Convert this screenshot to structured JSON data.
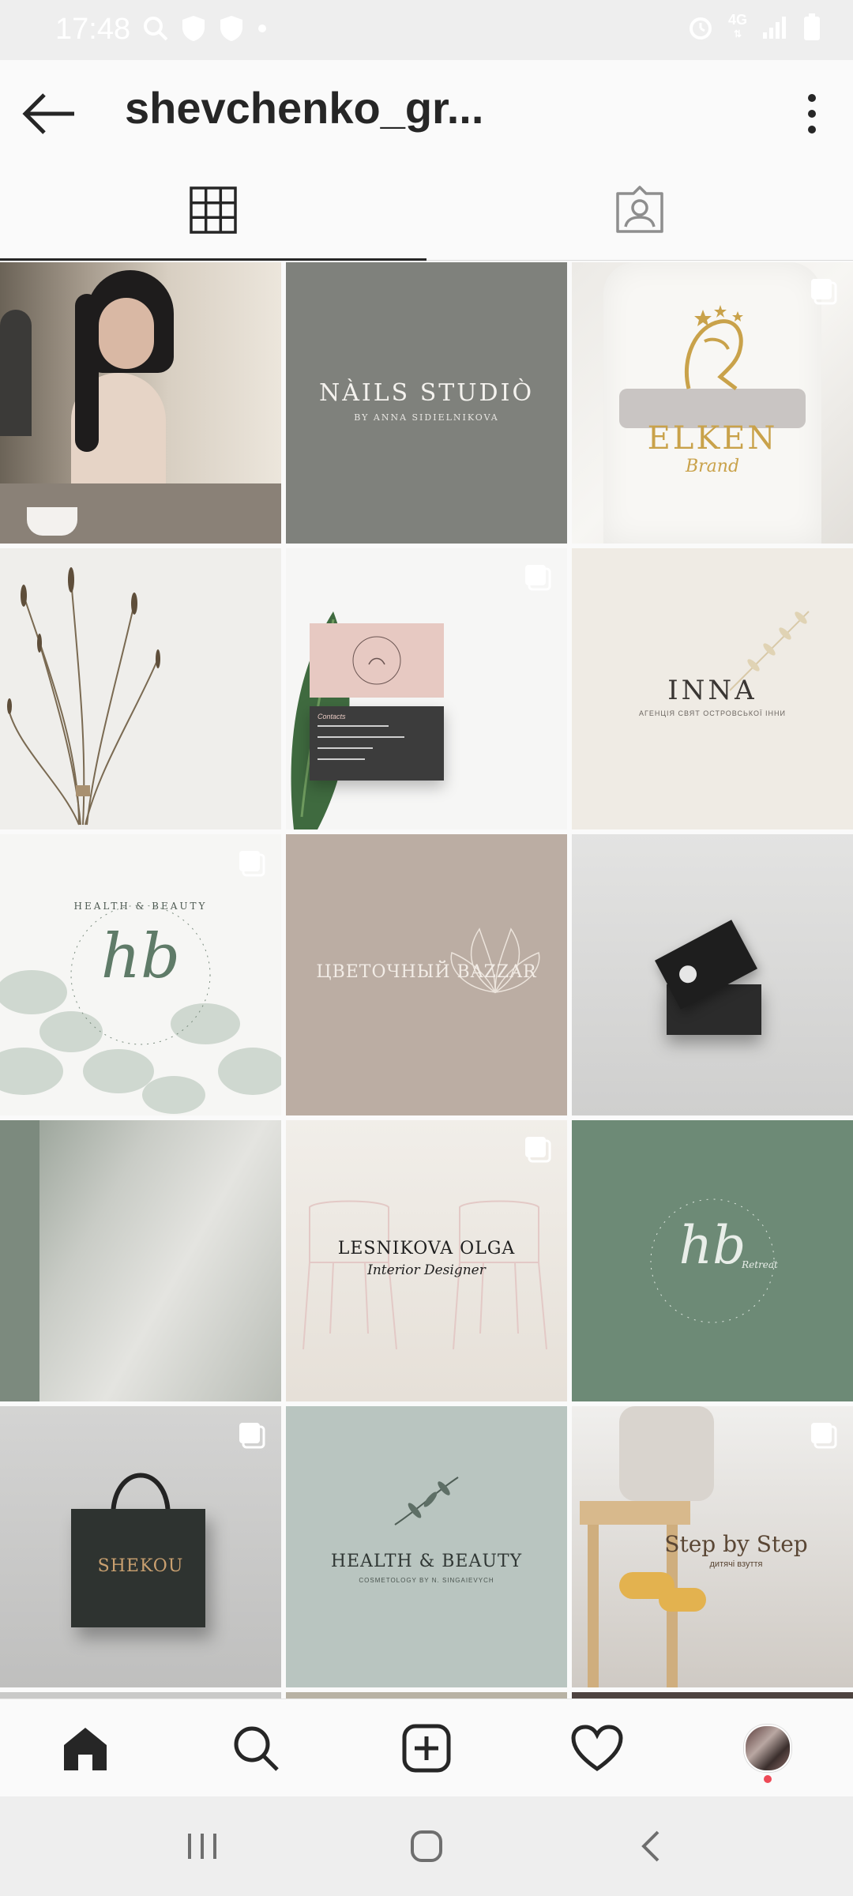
{
  "status_bar": {
    "time": "17:48",
    "left_icons": [
      "search-icon",
      "shield-icon",
      "shield-icon",
      "dot-icon"
    ],
    "right_icons": [
      "alarm-icon",
      "4g-icon",
      "signal-icon",
      "battery-icon"
    ],
    "network_label": "4G"
  },
  "header": {
    "title": "shevchenko_gr...",
    "back_icon": "arrow-left-icon",
    "more_icon": "more-vertical-icon"
  },
  "tabs": [
    {
      "name": "grid",
      "icon": "grid-icon",
      "active": true
    },
    {
      "name": "tagged",
      "icon": "tagged-person-icon",
      "active": false
    }
  ],
  "posts": [
    {
      "id": "portrait-photo",
      "text": "",
      "subtext": "",
      "multi": false
    },
    {
      "id": "nails-studio",
      "text": "NÀILS STUDIÒ",
      "subtext": "BY ANNA SIDIELNIKOVA",
      "multi": false
    },
    {
      "id": "elken-brand",
      "text": "ELKEN",
      "subtext": "Brand",
      "multi": true
    },
    {
      "id": "dried-flowers",
      "text": "",
      "subtext": "",
      "multi": false
    },
    {
      "id": "business-cards-pink",
      "text": "Contacts",
      "subtext": "",
      "multi": true
    },
    {
      "id": "inna",
      "text": "INNA",
      "subtext": "АГЕНЦІЯ СВЯТ ОСТРОВСЬКОЇ ІННИ",
      "multi": false
    },
    {
      "id": "hb-retreat",
      "text": "hb",
      "subtext": "HEALTH & BEAUTY",
      "multi": true
    },
    {
      "id": "bazzar",
      "text": "ЦВЕТОЧНЫЙ BAZZAR",
      "subtext": "",
      "multi": false
    },
    {
      "id": "black-cards",
      "text": "",
      "subtext": "",
      "multi": false
    },
    {
      "id": "shadow-wall",
      "text": "",
      "subtext": "",
      "multi": false
    },
    {
      "id": "lesnikova",
      "text": "LESNIKOVA OLGA",
      "subtext": "Interior Designer",
      "multi": true
    },
    {
      "id": "hb-green",
      "text": "hb",
      "subtext": "Retreat",
      "multi": false
    },
    {
      "id": "shekou-bag",
      "text": "SHEKOU",
      "subtext": "",
      "multi": true
    },
    {
      "id": "health-beauty",
      "text": "HEALTH & BEAUTY",
      "subtext": "COSMETOLOGY BY N. SINGAIEVYCH",
      "multi": false
    },
    {
      "id": "step-by-step",
      "text": "Step by Step",
      "subtext": "дитячі взуття",
      "multi": true
    }
  ],
  "bottom_nav": [
    {
      "name": "home",
      "icon": "home-icon"
    },
    {
      "name": "search",
      "icon": "search-icon"
    },
    {
      "name": "new-post",
      "icon": "plus-square-icon"
    },
    {
      "name": "activity",
      "icon": "heart-icon"
    },
    {
      "name": "profile",
      "icon": "avatar-icon"
    }
  ],
  "system_nav": [
    {
      "name": "recents",
      "icon": "recents-icon"
    },
    {
      "name": "home",
      "icon": "home-circle-icon"
    },
    {
      "name": "back",
      "icon": "chevron-left-icon"
    }
  ],
  "colors": {
    "accent": "#262626",
    "notification": "#ed4956",
    "status_bar": "#eeeeee"
  }
}
